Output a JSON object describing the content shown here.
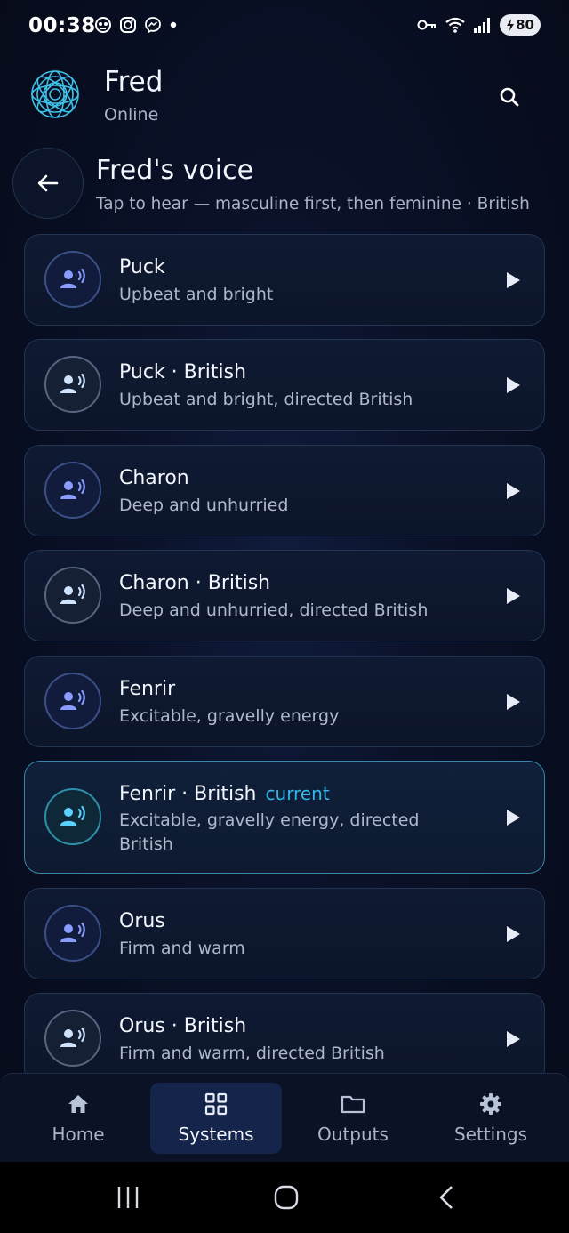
{
  "status_bar": {
    "time": "00:38",
    "battery": "80",
    "left_icons": [
      "skull-notification-icon",
      "instagram-icon",
      "messenger-icon",
      "dot-icon"
    ],
    "right_icons": [
      "key-icon",
      "wifi-icon",
      "signal-icon",
      "battery-icon"
    ]
  },
  "header": {
    "name": "Fred",
    "status": "Online"
  },
  "page": {
    "title": "Fred's voice",
    "subtitle": "Tap to hear — masculine first, then feminine · British"
  },
  "voices": [
    {
      "name": "Puck",
      "description": "Upbeat and bright",
      "british": false,
      "current": false
    },
    {
      "name": "Puck · British",
      "description": "Upbeat and bright, directed British",
      "british": true,
      "current": false
    },
    {
      "name": "Charon",
      "description": "Deep and unhurried",
      "british": false,
      "current": false
    },
    {
      "name": "Charon · British",
      "description": "Deep and unhurried, directed British",
      "british": true,
      "current": false
    },
    {
      "name": "Fenrir",
      "description": "Excitable, gravelly energy",
      "british": false,
      "current": false
    },
    {
      "name": "Fenrir · British",
      "description": "Excitable, gravelly energy, directed British",
      "british": true,
      "current": true
    },
    {
      "name": "Orus",
      "description": "Firm and warm",
      "british": false,
      "current": false
    },
    {
      "name": "Orus · British",
      "description": "Firm and warm, directed British",
      "british": true,
      "current": false
    }
  ],
  "current_label": "current",
  "bottom_nav": {
    "items": [
      {
        "label": "Home",
        "icon": "home-icon",
        "active": false
      },
      {
        "label": "Systems",
        "icon": "grid-icon",
        "active": true
      },
      {
        "label": "Outputs",
        "icon": "folder-icon",
        "active": false
      },
      {
        "label": "Settings",
        "icon": "gear-icon",
        "active": false
      }
    ]
  },
  "colors": {
    "background": "#0a1128",
    "accent": "#33b6e6",
    "card_border": "#243553",
    "current_border": "#3a86a8",
    "voice_icon": "#8a9cff",
    "british_icon": "#cfe3ff",
    "current_icon": "#5ad0ff"
  }
}
